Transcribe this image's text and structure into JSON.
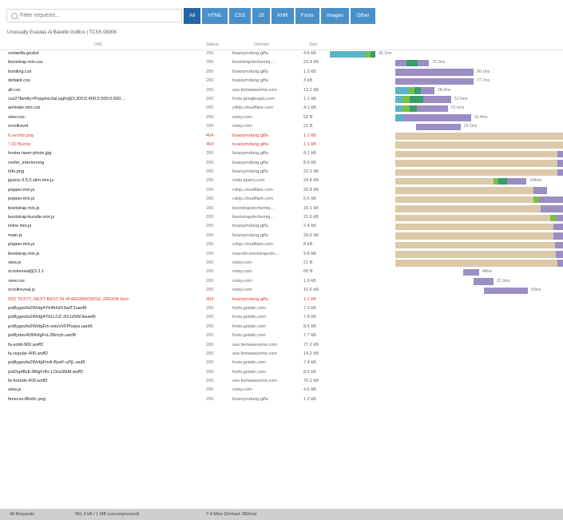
{
  "search": {
    "placeholder": "Filter requests..."
  },
  "filters": [
    "All",
    "HTML",
    "CSS",
    "JS",
    "XHR",
    "Fonts",
    "Images",
    "Other"
  ],
  "active_filter": "All",
  "subtitle": "Unusually Evaulas Ai Bavello Gofitss | TCSS 08306",
  "columns": {
    "url": "URL",
    "status": "Status",
    "domain": "Domain",
    "size": "Size"
  },
  "colors": {
    "accent": "#4a90c8",
    "active": "#2266a5",
    "error": "#e03c31",
    "wait": "#dcc9a8",
    "blocked": "#9b8ec4",
    "dns": "#5bb4c9",
    "connect": "#7ac143",
    "receive": "#3a9b6b"
  },
  "rows": [
    {
      "url": "vortaelfa.geslist",
      "status": "200",
      "domain": "boaisymdung.giflu",
      "size": "4.6 kB",
      "error": false
    },
    {
      "url": "bootstrap.min.css",
      "status": "200",
      "domain": "bootstrapshchemiq...",
      "size": "23.4 kB",
      "error": false
    },
    {
      "url": "bootling.css",
      "status": "200",
      "domain": "boaisymdung.giflu",
      "size": "1.3 kB",
      "error": false
    },
    {
      "url": "deltakit.css",
      "status": "200",
      "domain": "boaisymdung.giflu",
      "size": "3 kB",
      "error": false
    },
    {
      "url": "all.css",
      "status": "200",
      "domain": "use.fontawesome.com",
      "size": "13.2 kB",
      "error": false
    },
    {
      "url": "css2?family=Poppins:ital,wght@0,300;0,400;0,500;0,600;...",
      "status": "200",
      "domain": "fonts.googleapis.com",
      "size": "1.1 kB",
      "error": false
    },
    {
      "url": "animate.min.css",
      "status": "200",
      "domain": "cdnjs.cloudflare.com",
      "size": "4.1 kB",
      "error": false
    },
    {
      "url": "view.css",
      "status": "200",
      "domain": "ostsy.com",
      "size": "52 B",
      "error": false
    },
    {
      "url": "scrollrevel",
      "status": "200",
      "domain": "ostsy.com",
      "size": "21 B",
      "error": false
    },
    {
      "url": "6.sechto.png",
      "status": "404",
      "domain": "boaisymdung.giflu",
      "size": "1.1 kB",
      "error": true
    },
    {
      "url": "7.00 Bunny",
      "status": "404",
      "domain": "boaisymdung.giflu",
      "size": "1.1 kB",
      "error": true
    },
    {
      "url": "hoster-laser-photo.jpg",
      "status": "200",
      "domain": "boaisymdung.giflu",
      "size": "8.1 kB",
      "error": false
    },
    {
      "url": "roofer_interiorsmg",
      "status": "200",
      "domain": "boaisymdung.giflu",
      "size": "8.6 kB",
      "error": false
    },
    {
      "url": "tofu.png",
      "status": "200",
      "domain": "boaisymdung.giflu",
      "size": "23.1 kB",
      "error": false
    },
    {
      "url": "jquery-3.5.0.slim.min.js",
      "status": "200",
      "domain": "code.jquery.com",
      "size": "24.8 kB",
      "error": false
    },
    {
      "url": "popper.min.js",
      "status": "200",
      "domain": "cdnjs.cloudflare.com",
      "size": "20.8 kB",
      "error": false
    },
    {
      "url": "popper.min.js",
      "status": "200",
      "domain": "cdnjs.cloudflare.com",
      "size": "6.5 kB",
      "error": false
    },
    {
      "url": "bootstrap.min.js",
      "status": "200",
      "domain": "bootstrapshchemiq...",
      "size": "15.1 kB",
      "error": false
    },
    {
      "url": "bootstrap-bundle.min.js",
      "status": "200",
      "domain": "bootstrapshchemiq...",
      "size": "21.6 kB",
      "error": false
    },
    {
      "url": "inline.min.js",
      "status": "200",
      "domain": "boaisymdung.giflu",
      "size": "2.4 kB",
      "error": false
    },
    {
      "url": "main.js",
      "status": "200",
      "domain": "boaisymdung.giflu",
      "size": "29.6 kB",
      "error": false
    },
    {
      "url": "popper.min.js",
      "status": "200",
      "domain": "cdnjs.cloudflare.com",
      "size": "8 kB",
      "error": false
    },
    {
      "url": "bootstrap.min.js",
      "status": "200",
      "domain": "maxcdn.bootstrapcdn...",
      "size": "9.8 kB",
      "error": false
    },
    {
      "url": "view.js",
      "status": "200",
      "domain": "ostsy.com",
      "size": "21 B",
      "error": false
    },
    {
      "url": "scrolreveal@3.3.1",
      "status": "200",
      "domain": "ostsy.com",
      "size": "60 B",
      "error": false
    },
    {
      "url": "view.css",
      "status": "200",
      "domain": "ostsy.com",
      "size": "1.9 kB",
      "error": false
    },
    {
      "url": "scrollreveal.js",
      "status": "200",
      "domain": "ostsy.com",
      "size": "10.6 kB",
      "error": false
    },
    {
      "url": "N32 TEXT?_NEXT BEST IN #F4E03BROWSE_FROM4 Item",
      "status": "404",
      "domain": "boaisymdung.giflu",
      "size": "1.1 kB",
      "error": true
    },
    {
      "url": "pxi8ygavfw2Wsfg4Yk4h6dV3wtT2uanf6",
      "status": "200",
      "domain": "fonts.gstatic.com",
      "size": "7.3 kB",
      "error": false
    },
    {
      "url": "pxi8ygavfw2Wsfg4Yk1LOZ-2G1e5WJwuwf6",
      "status": "200",
      "domain": "fonts.gstatic.com",
      "size": "7.8 kB",
      "error": false
    },
    {
      "url": "pxi8ygavfw2WsfgFm-wxuVvFPhaws.uanf6",
      "status": "200",
      "domain": "fonts.gstatic.com",
      "size": "8.5 kB",
      "error": false
    },
    {
      "url": "pxi8ydav4t3WsfgFoL3Bmyh.uanf6",
      "status": "200",
      "domain": "fonts.gstatic.com",
      "size": "7.7 kB",
      "error": false
    },
    {
      "url": "fa-solid-900.woff2",
      "status": "200",
      "domain": "use.fontawesome.com",
      "size": "77.2 kB",
      "error": false
    },
    {
      "url": "fa-regular-400.woff2",
      "status": "200",
      "domain": "use.fontawesome.com",
      "size": "14.2 kB",
      "error": false
    },
    {
      "url": "pxi8ygavfw2WsfgFmA-ByeF-uPjL.wuf6",
      "status": "200",
      "domain": "fonts.gstatic.com",
      "size": "7.4 kB",
      "error": false
    },
    {
      "url": "pxiDypf8vE-8RgFrRr-LOza3IbM.woff2",
      "status": "200",
      "domain": "fonts.gstatic.com",
      "size": "8.5 kB",
      "error": false
    },
    {
      "url": "fa-brands-400.woff2",
      "status": "200",
      "domain": "use.fontawesome.com",
      "size": "76.2 kB",
      "error": false
    },
    {
      "url": "view.js",
      "status": "200",
      "domain": "ostsy.com",
      "size": "4.6 kB",
      "error": false
    },
    {
      "url": "fanecss-8bx0c.png",
      "status": "200",
      "domain": "boaisymdung.giflu",
      "size": "1.2 kB",
      "error": false
    }
  ],
  "timings": [
    {
      "segments": [
        [
          "dns",
          0,
          45
        ],
        [
          "connect",
          45,
          51
        ],
        [
          "receive",
          51,
          57
        ]
      ],
      "label": "90.1ms"
    },
    {
      "segments": [
        [
          "blocked",
          82,
          96
        ],
        [
          "receive",
          96,
          110
        ],
        [
          "blocked",
          110,
          124
        ]
      ],
      "label": "73.3ms"
    },
    {
      "segments": [
        [
          "blocked",
          82,
          180
        ]
      ],
      "label": "90.1ms"
    },
    {
      "segments": [
        [
          "blocked",
          82,
          180
        ]
      ],
      "label": "77.7ms"
    },
    {
      "segments": [
        [
          "dns",
          82,
          99
        ],
        [
          "connect",
          99,
          106
        ],
        [
          "receive",
          106,
          114
        ],
        [
          "blocked",
          114,
          131
        ]
      ],
      "label": "28.9ms"
    },
    {
      "segments": [
        [
          "dns",
          82,
          91
        ],
        [
          "connect",
          91,
          100
        ],
        [
          "receive",
          100,
          117
        ],
        [
          "blocked",
          117,
          152
        ]
      ],
      "label": "51.5ms"
    },
    {
      "segments": [
        [
          "dns",
          82,
          91
        ],
        [
          "connect",
          91,
          100
        ],
        [
          "receive",
          100,
          109
        ],
        [
          "blocked",
          109,
          148
        ]
      ],
      "label": "51.6ms"
    },
    {
      "segments": [
        [
          "dns",
          82,
          92
        ],
        [
          "blocked",
          92,
          177
        ]
      ],
      "label": "31.4ms"
    },
    {
      "segments": [
        [
          "blocked",
          108,
          164
        ]
      ],
      "label": "20.1ms"
    },
    {
      "segments": [
        [
          "wait",
          82,
          292
        ]
      ],
      "label": ""
    },
    {
      "segments": [
        [
          "wait",
          82,
          292
        ]
      ],
      "label": ""
    },
    {
      "segments": [
        [
          "wait",
          82,
          285
        ],
        [
          "blocked",
          285,
          292
        ]
      ],
      "label": ""
    },
    {
      "segments": [
        [
          "wait",
          82,
          285
        ],
        [
          "blocked",
          285,
          292
        ]
      ],
      "label": ""
    },
    {
      "segments": [
        [
          "wait",
          82,
          285
        ],
        [
          "blocked",
          285,
          292
        ]
      ],
      "label": ""
    },
    {
      "segments": [
        [
          "wait",
          82,
          205
        ],
        [
          "connect",
          205,
          211
        ],
        [
          "receive",
          211,
          222
        ],
        [
          "blocked",
          222,
          246
        ]
      ],
      "label": "149ms"
    },
    {
      "segments": [
        [
          "wait",
          82,
          255
        ],
        [
          "blocked",
          255,
          272
        ]
      ],
      "label": ""
    },
    {
      "segments": [
        [
          "wait",
          82,
          255
        ],
        [
          "connect",
          255,
          262
        ],
        [
          "blocked",
          262,
          292
        ]
      ],
      "label": ""
    },
    {
      "segments": [
        [
          "wait",
          82,
          264
        ],
        [
          "blocked",
          264,
          292
        ]
      ],
      "label": ""
    },
    {
      "segments": [
        [
          "wait",
          82,
          276
        ],
        [
          "connect",
          276,
          283
        ],
        [
          "blocked",
          283,
          292
        ]
      ],
      "label": ""
    },
    {
      "segments": [
        [
          "wait",
          82,
          280
        ],
        [
          "blocked",
          280,
          292
        ]
      ],
      "label": ""
    },
    {
      "segments": [
        [
          "wait",
          82,
          280
        ],
        [
          "blocked",
          280,
          292
        ]
      ],
      "label": ""
    },
    {
      "segments": [
        [
          "wait",
          82,
          282
        ],
        [
          "blocked",
          282,
          292
        ]
      ],
      "label": ""
    },
    {
      "segments": [
        [
          "wait",
          82,
          283
        ],
        [
          "blocked",
          283,
          292
        ]
      ],
      "label": ""
    },
    {
      "segments": [
        [
          "wait",
          82,
          285
        ],
        [
          "blocked",
          285,
          292
        ]
      ],
      "label": ""
    },
    {
      "segments": [
        [
          "blocked",
          167,
          187
        ]
      ],
      "label": "48ms"
    },
    {
      "segments": [
        [
          "blocked",
          180,
          205
        ]
      ],
      "label": "22.9ms"
    },
    {
      "segments": [
        [
          "blocked",
          193,
          248
        ]
      ],
      "label": "60ms"
    },
    {
      "segments": [],
      "label": ""
    },
    {
      "segments": [],
      "label": ""
    },
    {
      "segments": [],
      "label": ""
    },
    {
      "segments": [],
      "label": ""
    },
    {
      "segments": [],
      "label": ""
    },
    {
      "segments": [],
      "label": ""
    },
    {
      "segments": [],
      "label": ""
    },
    {
      "segments": [],
      "label": ""
    },
    {
      "segments": [],
      "label": ""
    },
    {
      "segments": [],
      "label": ""
    },
    {
      "segments": [],
      "label": ""
    },
    {
      "segments": [],
      "label": ""
    }
  ],
  "footer": {
    "requests": "40 Requests",
    "transferred": "561.9 kB / 1 MB (uncompressed)",
    "finish": "7.4 Mins   (Onload: 982ms)"
  }
}
